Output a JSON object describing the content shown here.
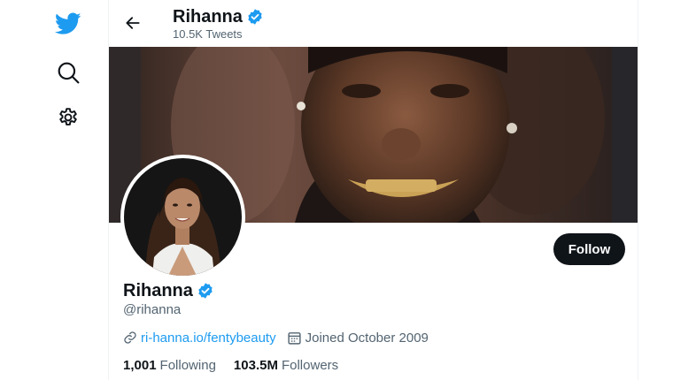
{
  "nav": {
    "icons": [
      "twitter-bird-icon",
      "search-icon",
      "gear-icon"
    ]
  },
  "header": {
    "display_name": "Rihanna",
    "tweet_count": "10.5K Tweets"
  },
  "profile": {
    "display_name": "Rihanna",
    "handle": "@rihanna",
    "website": "ri-hanna.io/fentybeauty",
    "joined": "Joined October 2009",
    "following_count": "1,001",
    "following_label": "Following",
    "followers_count": "103.5M",
    "followers_label": "Followers",
    "follow_button": "Follow",
    "verified": true
  },
  "colors": {
    "accent": "#1d9bf0",
    "text_primary": "#0f1419",
    "text_secondary": "#536471",
    "follow_button_bg": "#0f1419"
  }
}
